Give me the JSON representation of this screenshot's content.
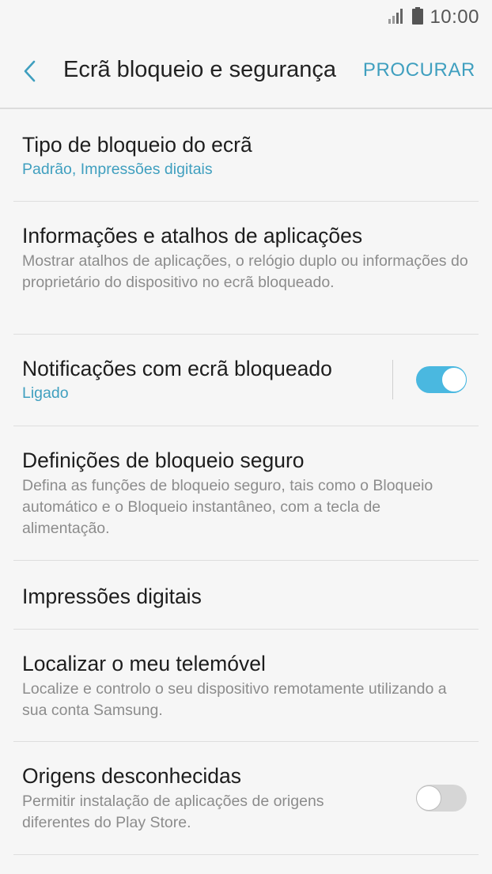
{
  "status_bar": {
    "time": "10:00",
    "icons": [
      "signal-icon",
      "battery-icon"
    ]
  },
  "app_bar": {
    "back_icon": "chevron-left-icon",
    "title": "Ecrã bloqueio e segurança",
    "search_label": "PROCURAR",
    "accent_color": "#3f9fbf"
  },
  "items": [
    {
      "title": "Tipo de bloqueio do ecrã",
      "subtitle": "Padrão, Impressões digitais"
    },
    {
      "title": "Informações e atalhos de aplicações",
      "subtitle": "Mostrar atalhos de aplicações, o relógio duplo ou informações do proprietário do dispositivo no ecrã bloqueado."
    },
    {
      "title": "Notificações com ecrã bloqueado",
      "subtitle": "Ligado",
      "toggle": "on"
    },
    {
      "title": "Definições de bloqueio seguro",
      "subtitle": "Defina as funções de bloqueio seguro, tais como o Bloqueio automático e o Bloqueio instantâneo, com a tecla de alimentação."
    },
    {
      "title": "Impressões digitais"
    },
    {
      "title": "Localizar o meu telemóvel",
      "subtitle": "Localize e controlo o seu dispositivo remotamente utilizando a sua conta Samsung."
    },
    {
      "title": "Origens desconhecidas",
      "subtitle": "Permitir instalação de aplicações de origens diferentes do Play Store.",
      "toggle": "off"
    }
  ]
}
